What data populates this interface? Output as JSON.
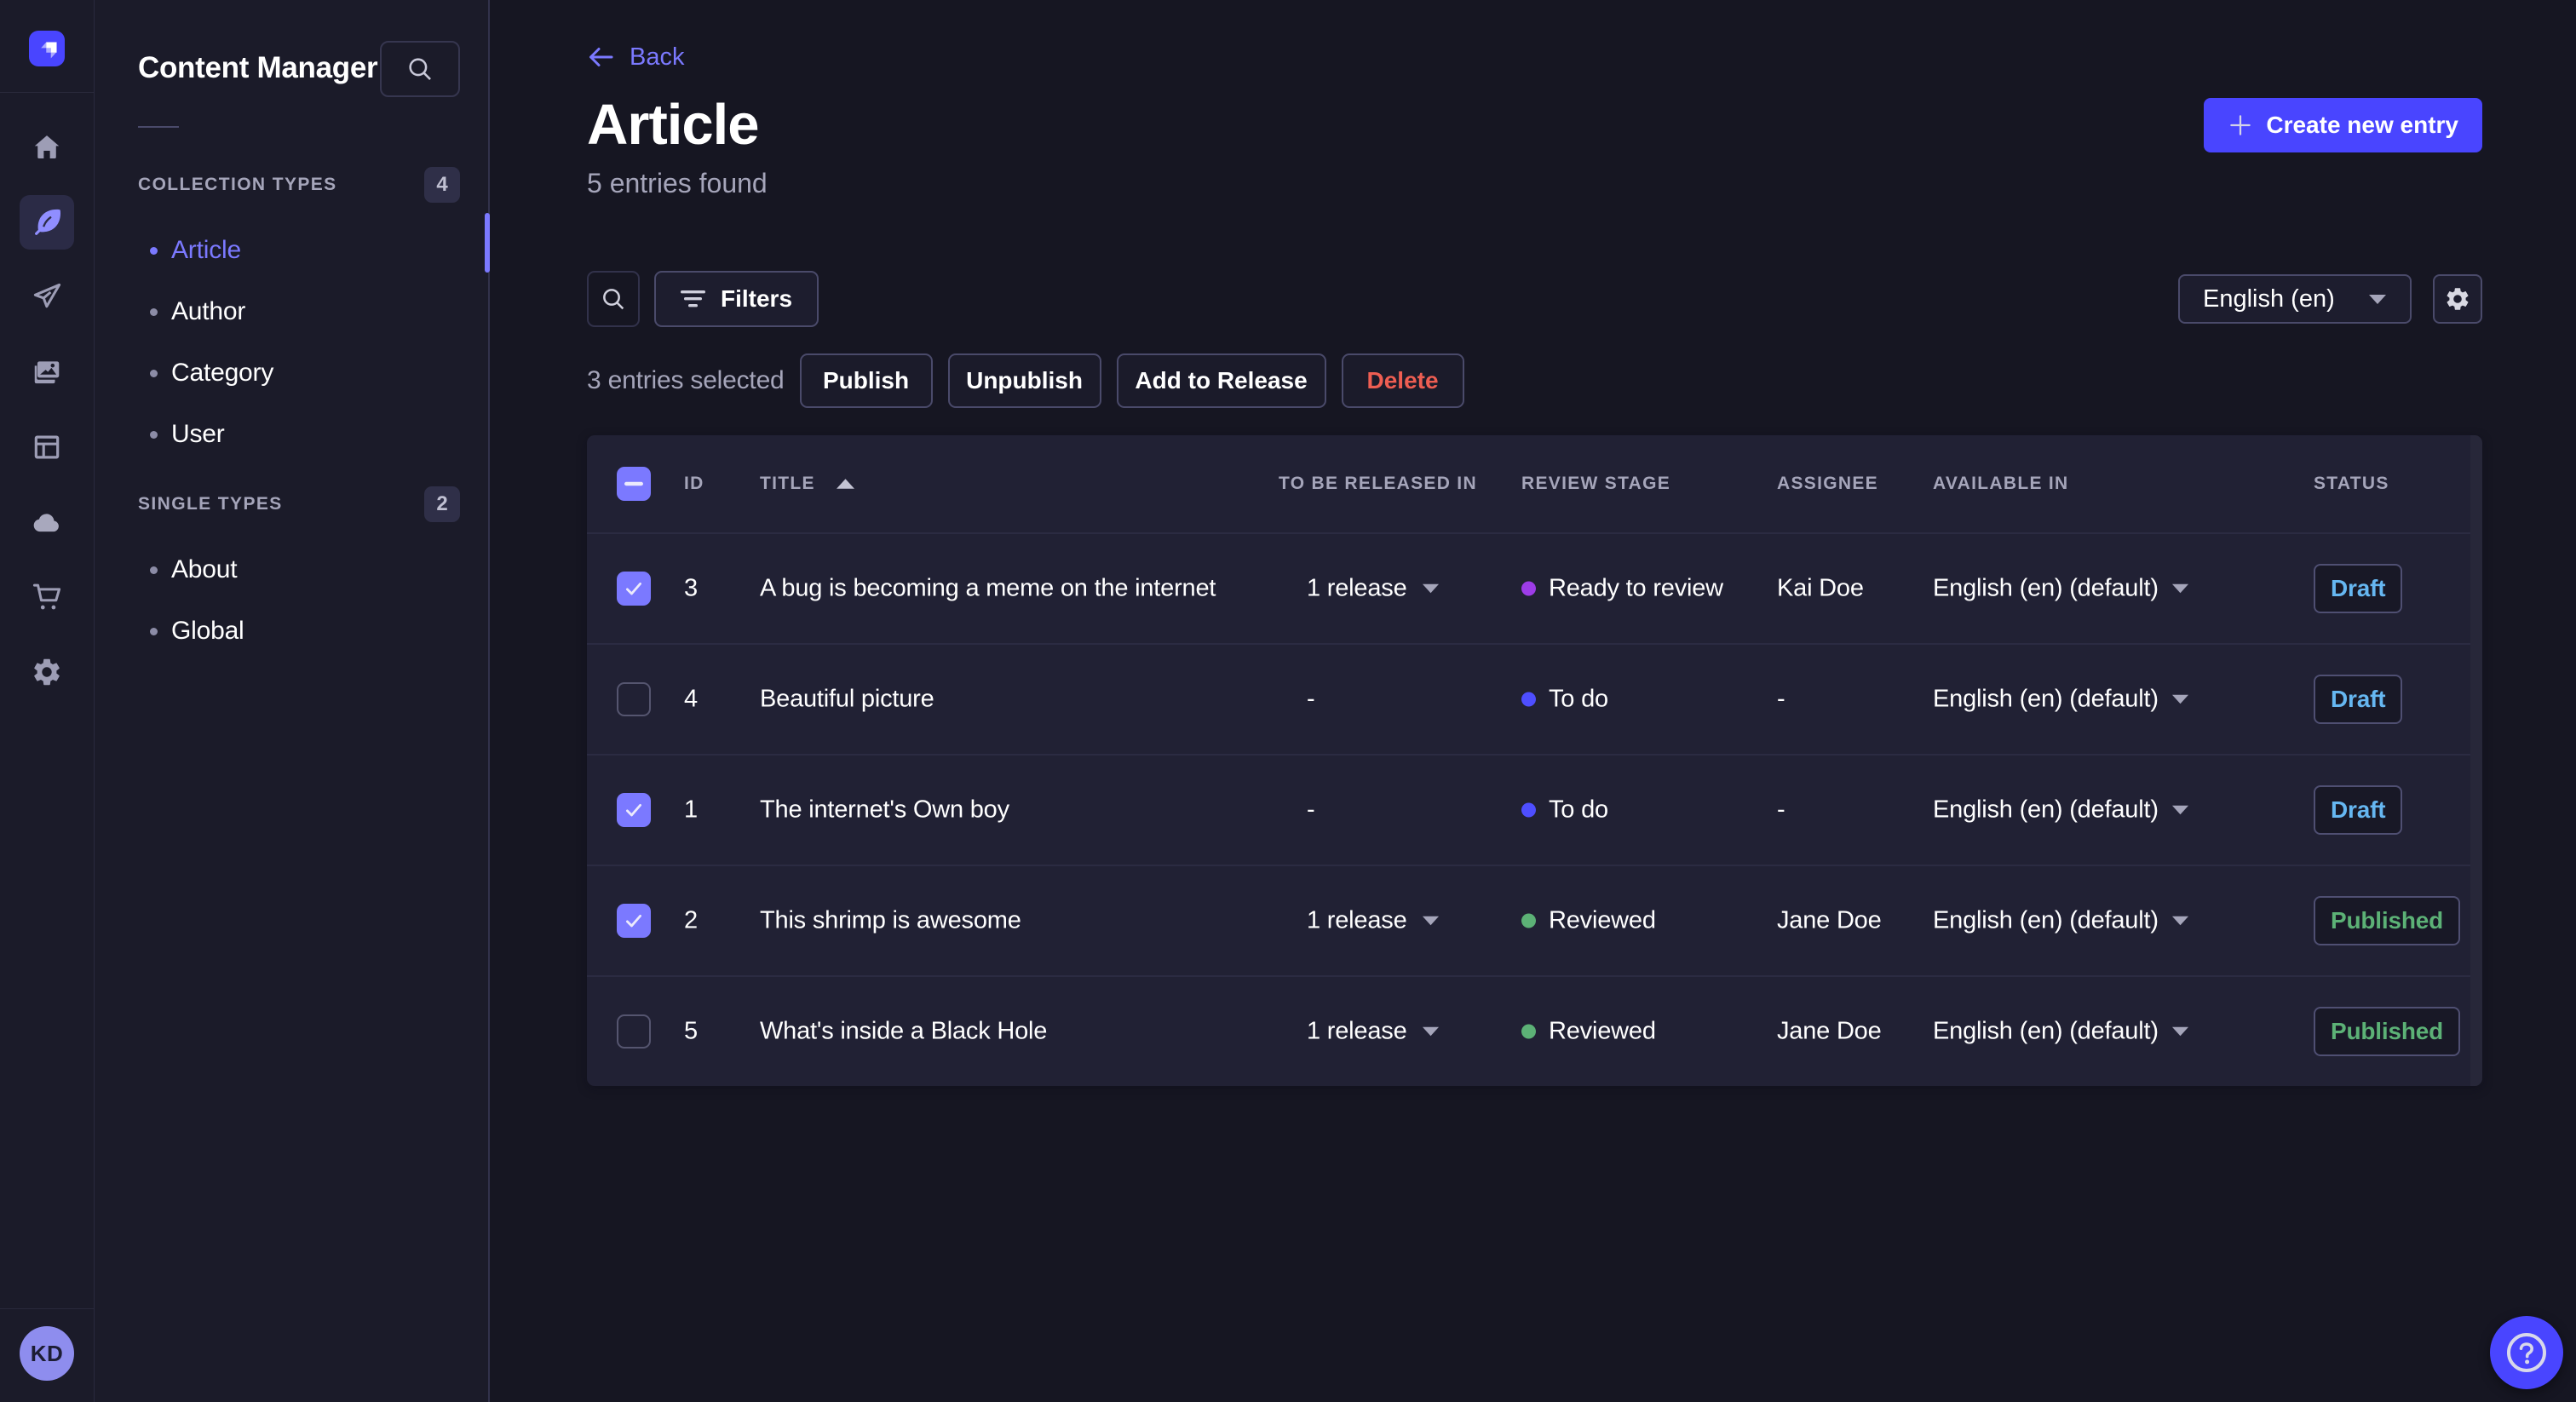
{
  "rail": {
    "logo": "strapi-logo",
    "items": [
      {
        "name": "home"
      },
      {
        "name": "content-manager",
        "active": true
      },
      {
        "name": "releases"
      },
      {
        "name": "media-library"
      },
      {
        "name": "content-type-builder"
      },
      {
        "name": "deploy"
      },
      {
        "name": "marketplace"
      },
      {
        "name": "settings"
      }
    ],
    "avatar_initials": "KD"
  },
  "sidebar": {
    "title": "Content Manager",
    "sections": [
      {
        "label": "COLLECTION TYPES",
        "count": "4",
        "items": [
          {
            "label": "Article",
            "active": true
          },
          {
            "label": "Author"
          },
          {
            "label": "Category"
          },
          {
            "label": "User"
          }
        ]
      },
      {
        "label": "SINGLE TYPES",
        "count": "2",
        "items": [
          {
            "label": "About"
          },
          {
            "label": "Global"
          }
        ]
      }
    ]
  },
  "header": {
    "back_label": "Back",
    "title": "Article",
    "subtitle": "5 entries found",
    "create_label": "Create new entry"
  },
  "toolbar": {
    "filters_label": "Filters",
    "locale_value": "English (en)"
  },
  "selection": {
    "text": "3 entries selected",
    "publish_label": "Publish",
    "unpublish_label": "Unpublish",
    "add_to_release_label": "Add to Release",
    "delete_label": "Delete"
  },
  "table": {
    "columns": {
      "id": "ID",
      "title": "TITLE",
      "released": "TO BE RELEASED IN",
      "review": "REVIEW STAGE",
      "assignee": "ASSIGNEE",
      "available": "AVAILABLE IN",
      "status": "STATUS"
    },
    "rows": [
      {
        "checked": true,
        "id": "3",
        "title": "A bug is becoming a meme on the internet",
        "released": "1 release",
        "review": "Ready to review",
        "review_color": "#9d3ce8",
        "assignee": "Kai Doe",
        "available": "English (en) (default)",
        "status": "Draft"
      },
      {
        "checked": false,
        "id": "4",
        "title": "Beautiful picture",
        "released": "-",
        "review": "To do",
        "review_color": "#4e4eff",
        "assignee": "-",
        "available": "English (en) (default)",
        "status": "Draft"
      },
      {
        "checked": true,
        "id": "1",
        "title": "The internet's Own boy",
        "released": "-",
        "review": "To do",
        "review_color": "#4e4eff",
        "assignee": "-",
        "available": "English (en) (default)",
        "status": "Draft"
      },
      {
        "checked": true,
        "id": "2",
        "title": "This shrimp is awesome",
        "released": "1 release",
        "review": "Reviewed",
        "review_color": "#5cb176",
        "assignee": "Jane Doe",
        "available": "English (en) (default)",
        "status": "Published"
      },
      {
        "checked": false,
        "id": "5",
        "title": "What's inside a Black Hole",
        "released": "1 release",
        "review": "Reviewed",
        "review_color": "#5cb176",
        "assignee": "Jane Doe",
        "available": "English (en) (default)",
        "status": "Published"
      }
    ]
  },
  "colors": {
    "accent": "#4945ff",
    "accent_light": "#7b79ff",
    "danger": "#ee5e52",
    "success": "#5cb176",
    "info": "#66b7f1"
  }
}
